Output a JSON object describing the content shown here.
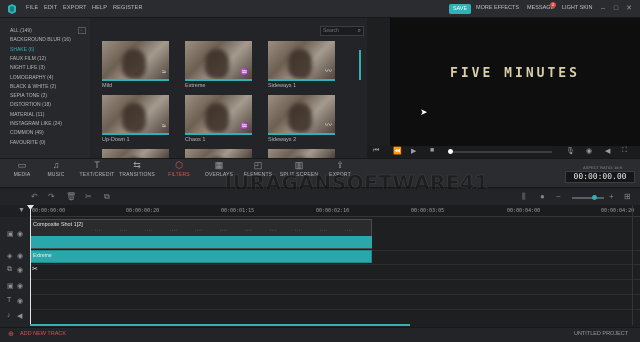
{
  "menubar": {
    "items": [
      "FILE",
      "EDIT",
      "EXPORT",
      "HELP",
      "REGISTER"
    ],
    "save": "SAVE",
    "right_items": [
      "MORE EFFECTS",
      "MESSAGE",
      "LIGHT SKIN"
    ],
    "message_badge": "2",
    "accent": "#2fb1b5"
  },
  "library": {
    "categories": [
      "ALL (149)",
      "BACKGROUND BLUR (16)",
      "SHAKE (6)",
      "FAUX FILM (12)",
      "NIGHT LIFE (3)",
      "LOMOGRAPHY (4)",
      "BLACK & WHITE (2)",
      "SEPIA TONE (2)",
      "DISTORTION (18)",
      "MATERIAL (11)",
      "INSTAGRAM LIKE (24)",
      "COMMON (49)",
      "FAVOURITE (0)"
    ],
    "active_category": 2,
    "search_placeholder": "Search",
    "thumbnails": [
      "Mild",
      "Extreme",
      "Sideways 1",
      "Up-Down 1",
      "Chaos 1",
      "Sideways 2",
      "",
      "",
      ""
    ]
  },
  "preview": {
    "title_text": "FIVE MINUTES"
  },
  "toolbar": {
    "tools": [
      "MEDIA",
      "MUSIC",
      "TEXT/CREDIT",
      "TRANSITIONS",
      "FILTERS",
      "OVERLAYS",
      "ELEMENTS",
      "SPLIT SCREEN",
      "EXPORT"
    ],
    "active_tool": 4,
    "aspect_ratio": "ASPECT RATIO: 16:9",
    "timecode": "00:00:00.00"
  },
  "watermark": "JURAGANSOFTWARE41",
  "ruler": [
    "00:00:00:00",
    "00:00:00:20",
    "00:00:01:15",
    "00:00:02:10",
    "00:00:03:05",
    "00:00:04:00",
    "00:00:04:20"
  ],
  "timeline": {
    "video_clip": "Composite Shot 1[2]",
    "fx_clip": "Extreme"
  },
  "bottom": {
    "add_track": "ADD NEW TRACK",
    "project": "UNTITLED PROJECT"
  }
}
